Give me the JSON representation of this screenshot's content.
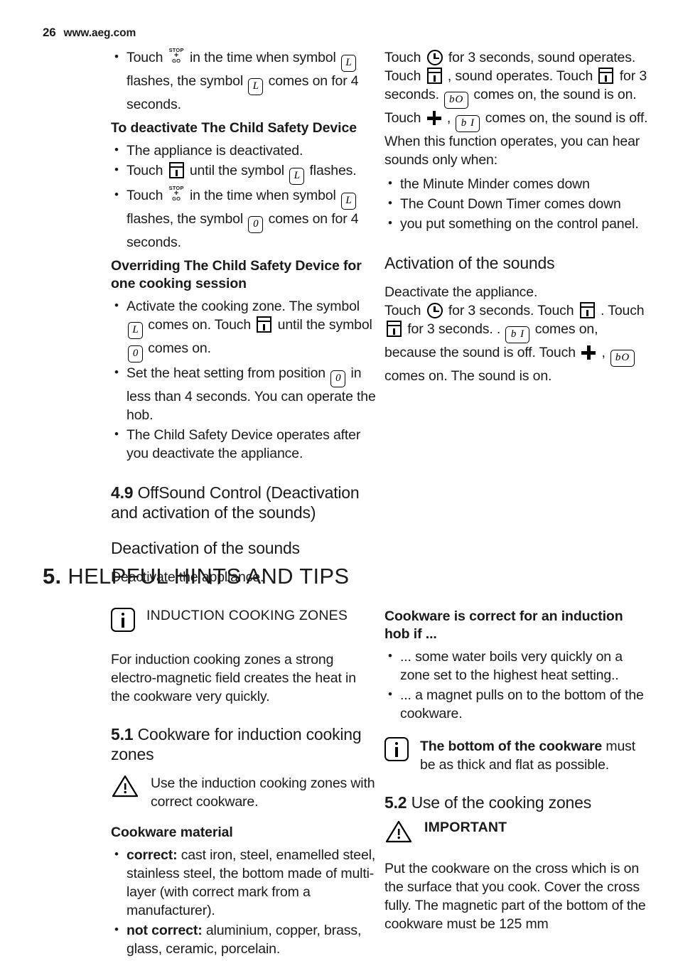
{
  "header": {
    "page_number": "26",
    "site": "www.aeg.com"
  },
  "symbols": {
    "lock_L": "L",
    "zero": "0",
    "sound_on": "bO",
    "sound_off": "b I",
    "stop": "STOP",
    "plus": "+",
    "go": "GO",
    "timer_icon": "timer-icon",
    "clock_icon": "clock-on-off-icon",
    "plus_icon": "plus-icon",
    "info_icon": "info-icon",
    "warning_icon": "warning-triangle-icon"
  },
  "left_column": {
    "bullet_touch_stopgo_1": {
      "pre": "Touch",
      "mid": "in the time when symbol",
      "mid2": "flashes, the symbol",
      "post": "comes on for 4 seconds.",
      "symbol_a": "L",
      "symbol_b": "L"
    },
    "h3_deactivate_child_safety": "To deactivate The Child Safety Device",
    "bullet_appliance_deactivated": "The appliance is deactivated.",
    "bullet_touch_until": {
      "pre": "Touch",
      "mid": "until the symbol",
      "post": "flashes.",
      "symbol": "L"
    },
    "bullet_touch_stopgo_2": {
      "pre": "Touch",
      "mid": "in the time when symbol",
      "mid2": "flashes, the symbol",
      "post": "comes on for 4 seconds.",
      "symbol_a": "L",
      "symbol_b": "0"
    },
    "h3_overriding": "Overriding The Child Safety Device for one cooking session",
    "bullet_activate_zone": {
      "p1": "Activate the cooking zone. The symbol",
      "p2": "comes on. Touch",
      "p3": "until the symbol",
      "p4": "comes on.",
      "symbol_a": "L",
      "symbol_b": "0"
    },
    "bullet_set_heat": {
      "p1": "Set the heat setting from position",
      "p2": "in less than 4 seconds. You can operate the hob.",
      "symbol": "0"
    },
    "bullet_child_safety_operates": "The Child Safety Device operates after you deactivate the appliance.",
    "h2_offsound": {
      "num": "4.9",
      "text": "OffSound Control (Deactivation and activation of the sounds)"
    },
    "h2_deactivation_sounds": "Deactivation of the sounds",
    "para_deactivate_appliance": "Deactivate the appliance."
  },
  "right_column": {
    "para_touch_sequence": {
      "s1": "Touch",
      "s2": "for 3 seconds, sound operates. Touch",
      "s3": ", sound operates. Touch",
      "s4": "for 3 seconds.",
      "s5": "comes on, the sound is on. Touch",
      "s6": ",",
      "s7": "comes on, the sound is off.",
      "sym_sound_on": "bO",
      "sym_sound_off": "b I"
    },
    "para_when_function": "When this function operates, you can hear sounds only when:",
    "bullets_sounds": [
      "the Minute Minder comes down",
      "The Count Down Timer comes down",
      "you put something on the control panel."
    ],
    "h2_activation_sounds": "Activation of the sounds",
    "para_activation": {
      "l1": "Deactivate the appliance.",
      "s1": "Touch",
      "s2": "for 3 seconds. Touch",
      "s3": ".",
      "s4": "Touch",
      "s5": "for 3 seconds. .",
      "s6": "comes on, because the sound is off. Touch",
      "s7": ",",
      "s8": "comes on. The sound is on.",
      "sym_sound_off": "b I",
      "sym_sound_on": "bO"
    }
  },
  "section5": {
    "heading": {
      "num": "5.",
      "text": "HELPFUL HINTS AND TIPS"
    },
    "left": {
      "note_induction_label": "INDUCTION COOKING ZONES",
      "para_induction": "For induction cooking zones a strong electro-magnetic field creates the heat in the cookware very quickly.",
      "h2_cookware": {
        "num": "5.1",
        "text": "Cookware for induction cooking zones"
      },
      "warning_use_induction": "Use the induction cooking zones with correct cookware.",
      "h3_cookware_material": "Cookware material",
      "bullet_correct": {
        "label": "correct:",
        "text": " cast iron, steel, enamelled steel, stainless steel, the bottom made of multi-layer (with correct mark from a manufacturer)."
      },
      "bullet_not_correct": {
        "label": "not correct:",
        "text": " aluminium, copper, brass, glass, ceramic, porcelain."
      }
    },
    "right": {
      "h3_cookware_correct": "Cookware is correct for an induction hob if ...",
      "bullets_correct": [
        "... some water boils very quickly on a zone set to the highest heat setting..",
        "... a magnet pulls on to the bottom of the cookware."
      ],
      "note_bottom": {
        "bold": "The bottom of the cookware",
        "text": " must be as thick and flat as possible."
      },
      "h2_use_zones": {
        "num": "5.2",
        "text": "Use of the cooking zones"
      },
      "important_label": "IMPORTANT",
      "para_put_cookware": "Put the cookware on the cross which is on the surface that you cook. Cover the cross fully. The magnetic part of the bottom of the cookware must be 125 mm"
    }
  }
}
